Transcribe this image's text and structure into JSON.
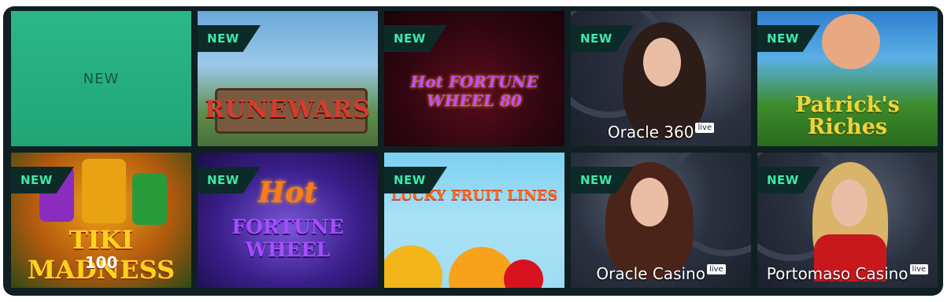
{
  "badge_label": "NEW",
  "tiles": [
    {
      "id": "placeholder",
      "placeholder_text": "NEW"
    },
    {
      "id": "runewars",
      "art_title": "RUNEWARS"
    },
    {
      "id": "hot-fortune-wheel-80",
      "art_title": "Hot FORTUNE WHEEL 80"
    },
    {
      "id": "oracle-360",
      "caption": "Oracle 360",
      "live_tag": "live"
    },
    {
      "id": "patricks-riches",
      "art_title": "Patrick's Riches"
    },
    {
      "id": "tiki-madness",
      "art_title": "TIKI MADNESS",
      "art_sub": "100"
    },
    {
      "id": "hot-fortune-wheel",
      "art_hot": "Hot",
      "art_title": "FORTUNE WHEEL"
    },
    {
      "id": "lucky-fruit-lines",
      "art_title": "LUCKY FRUIT LINES"
    },
    {
      "id": "oracle-casino",
      "caption": "Oracle Casino",
      "live_tag": "live"
    },
    {
      "id": "portomaso-casino",
      "caption": "Portomaso Casino",
      "live_tag": "live"
    }
  ],
  "colors": {
    "frame": "#0f1f22",
    "badge_bg": "#0c2b28",
    "badge_text": "#3fe8a8",
    "placeholder": "#2bb787"
  }
}
